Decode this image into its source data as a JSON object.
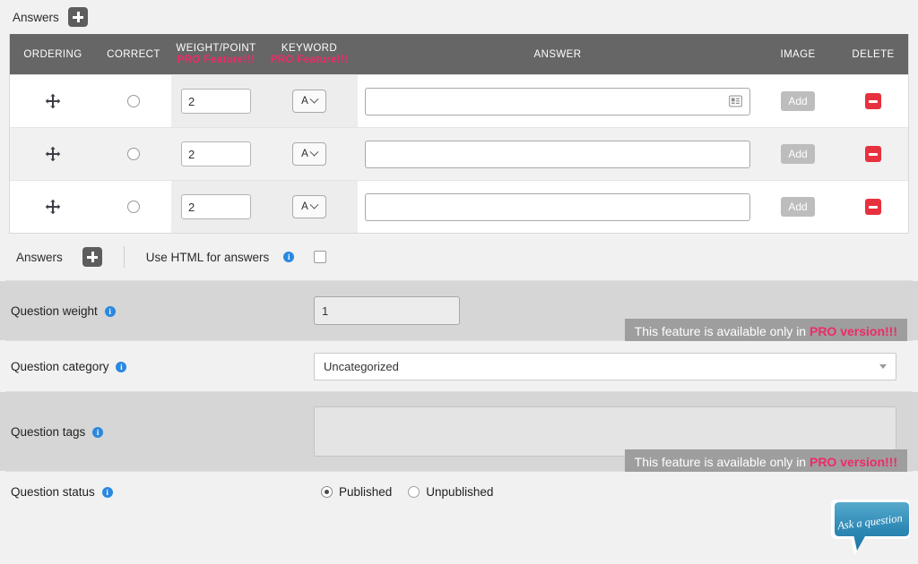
{
  "answers_top": {
    "label": "Answers",
    "add_icon": "plus-icon"
  },
  "table": {
    "headers": {
      "ordering": "ORDERING",
      "correct": "CORRECT",
      "weight": "WEIGHT/POINT",
      "weight_pro": "PRO Feature!!!",
      "keyword": "KEYWORD",
      "keyword_pro": "PRO Feature!!!",
      "answer": "ANSWER",
      "image": "IMAGE",
      "delete": "DELETE"
    },
    "rows": [
      {
        "weight": "2",
        "keyword": "A",
        "answer": "",
        "image_button": "Add",
        "has_card_icon": true
      },
      {
        "weight": "2",
        "keyword": "A",
        "answer": "",
        "image_button": "Add",
        "has_card_icon": false
      },
      {
        "weight": "2",
        "keyword": "A",
        "answer": "",
        "image_button": "Add",
        "has_card_icon": false
      }
    ]
  },
  "answers_bottom": {
    "label": "Answers",
    "use_html_label": "Use HTML for answers",
    "checkbox_checked": false
  },
  "fields": {
    "question_weight": {
      "label": "Question weight",
      "value": "1"
    },
    "question_category": {
      "label": "Question category",
      "value": "Uncategorized"
    },
    "question_tags": {
      "label": "Question tags",
      "value": ""
    },
    "question_status": {
      "label": "Question status",
      "options": [
        "Published",
        "Unpublished"
      ],
      "selected": "Published"
    }
  },
  "pro_banner": {
    "prefix": "This feature is available only in ",
    "emphasis": "PRO version!!!"
  },
  "chat_widget": {
    "text": "Ask a question"
  },
  "colors": {
    "header_bg": "#666666",
    "pro_pink": "#ef2a68",
    "delete_red": "#e8313f",
    "info_blue": "#2a88e0",
    "bubble_blue": "#2e89b5"
  }
}
